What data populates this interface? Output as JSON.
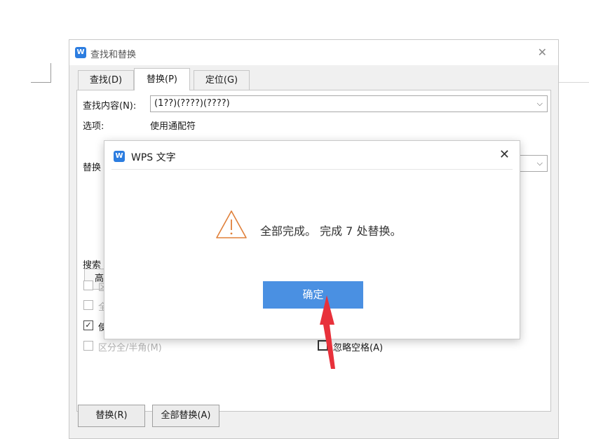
{
  "find_replace": {
    "logo": "W",
    "title": "查找和替换",
    "tabs": [
      {
        "label": "查找(D)"
      },
      {
        "label": "替换(P)"
      },
      {
        "label": "定位(G)"
      }
    ],
    "find_label": "查找内容(N):",
    "find_value": "(1??)(????)(????)",
    "options_label": "选项:",
    "options_value": "使用通配符",
    "replace_label_visible": "替换",
    "more_button_visible": "高",
    "search_label_visible": "搜索",
    "checkbox_fragments": [
      {
        "text": "区",
        "checked": false
      },
      {
        "text": "全",
        "checked": false
      },
      {
        "text": "使",
        "checked": true
      }
    ],
    "half_full_label": "区分全/半角(M)",
    "ignore_space_label": "忽略空格(A)",
    "replace_button": "替换(R)",
    "replace_all_button": "全部替换(A)"
  },
  "message_box": {
    "logo": "W",
    "title": "WPS 文字",
    "message": "全部完成。 完成 7 处替换。",
    "ok_button": "确定",
    "icon": "warning-icon"
  },
  "annotation": {
    "icon": "red-arrow-icon",
    "color": "#e8313b"
  },
  "colors": {
    "accent": "#4a90e2",
    "logo_blue": "#2c7de0",
    "warning": "#e0803a"
  }
}
